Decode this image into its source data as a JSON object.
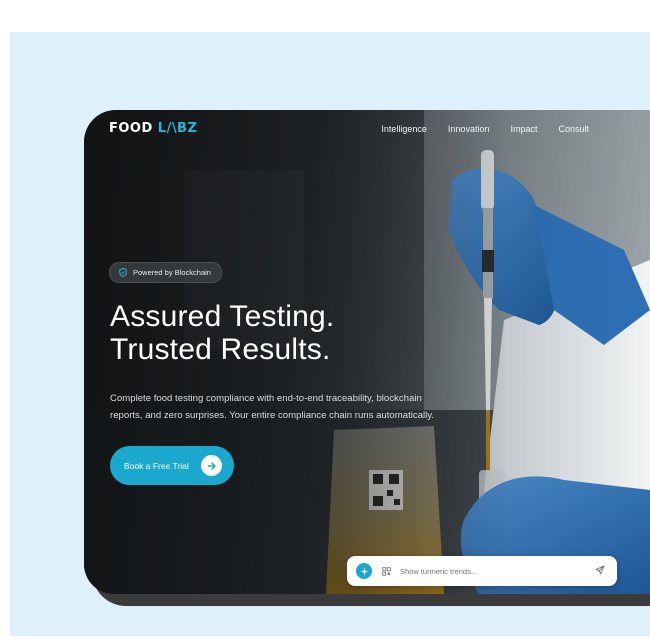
{
  "logo": {
    "main": "FOOD",
    "accent": "L/\\BZ"
  },
  "nav": {
    "items": [
      "Intelligence",
      "Innovation",
      "Impact",
      "Consult"
    ]
  },
  "badge": {
    "text": "Powered by Blockchain",
    "icon": "shield-icon"
  },
  "hero": {
    "title_line1": "Assured Testing.",
    "title_line2": "Trusted Results.",
    "desc_line1": "Complete food testing compliance with end-to-end traceability, blockchain",
    "desc_line2": "reports, and zero surprises. Your entire compliance chain runs automatically."
  },
  "cta": {
    "label": "Book a Free Trial",
    "icon": "arrow-right-icon"
  },
  "chatbar": {
    "placeholder": "Show turmeric trends...",
    "ai_icon": "sparkle-icon",
    "scan_icon": "qr-scan-icon",
    "send_icon": "send-icon"
  },
  "colors": {
    "accent": "#1ba8cf",
    "page_background": "#def0fc",
    "text": "#ffffff"
  }
}
